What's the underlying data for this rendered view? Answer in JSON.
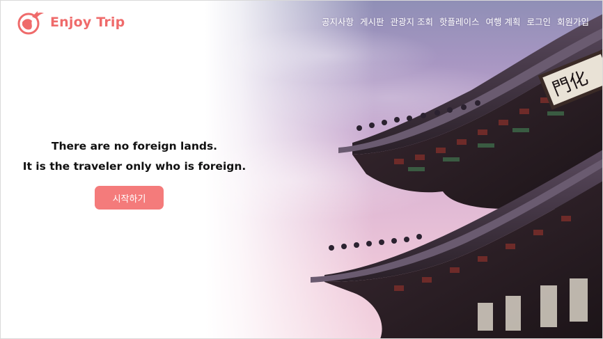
{
  "brand": {
    "name": "Enjoy Trip",
    "color": "#ef6b6b",
    "icon": "globe-bird-logo-icon"
  },
  "nav": {
    "items": [
      {
        "label": "공지사항"
      },
      {
        "label": "게시판"
      },
      {
        "label": "관광지 조회"
      },
      {
        "label": "핫플레이스"
      },
      {
        "label": "여행 계획"
      },
      {
        "label": "로그인"
      },
      {
        "label": "회원가입"
      }
    ]
  },
  "hero": {
    "line1": "There are no foreign lands.",
    "line2": "It is the traveler only who is foreign.",
    "cta_label": "시작하기",
    "cta_color": "#f47b7b",
    "background": "palace-roof-photo"
  }
}
